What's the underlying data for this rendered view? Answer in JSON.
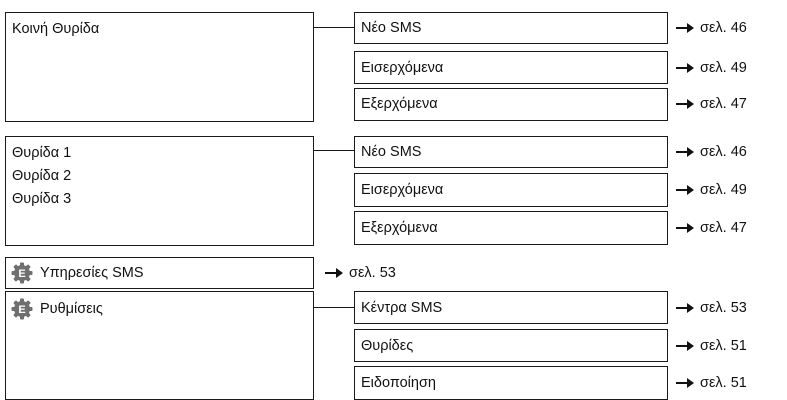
{
  "groups": [
    {
      "left": [
        "Κοινή Θυρίδα"
      ],
      "sub": [
        {
          "label": "Νέο SMS",
          "ref": "σελ. 46"
        },
        {
          "label": "Εισερχόμενα",
          "ref": "σελ. 49"
        },
        {
          "label": "Εξερχόμενα",
          "ref": "σελ. 47"
        }
      ]
    },
    {
      "left": [
        "Θυρίδα 1",
        "Θυρίδα 2",
        "Θυρίδα 3"
      ],
      "sub": [
        {
          "label": "Νέο SMS",
          "ref": "σελ. 46"
        },
        {
          "label": "Εισερχόμενα",
          "ref": "σελ. 49"
        },
        {
          "label": "Εξερχόμενα",
          "ref": "σελ. 47"
        }
      ]
    },
    {
      "left": [
        "Υπηρεσίες SMS"
      ],
      "icon": "expert-mode-gear-icon",
      "ref": "σελ. 53"
    },
    {
      "left": [
        "Ρυθμίσεις"
      ],
      "icon": "expert-mode-gear-icon",
      "sub": [
        {
          "label": "Κέντρα SMS",
          "ref": "σελ. 53"
        },
        {
          "label": "Θυρίδες",
          "ref": "σελ. 51"
        },
        {
          "label": "Ειδοποίηση",
          "ref": "σελ. 51"
        }
      ]
    }
  ],
  "icon_glyph": "E",
  "colors": {
    "icon": "#6f6f6f",
    "border": "#1a1a1a"
  }
}
